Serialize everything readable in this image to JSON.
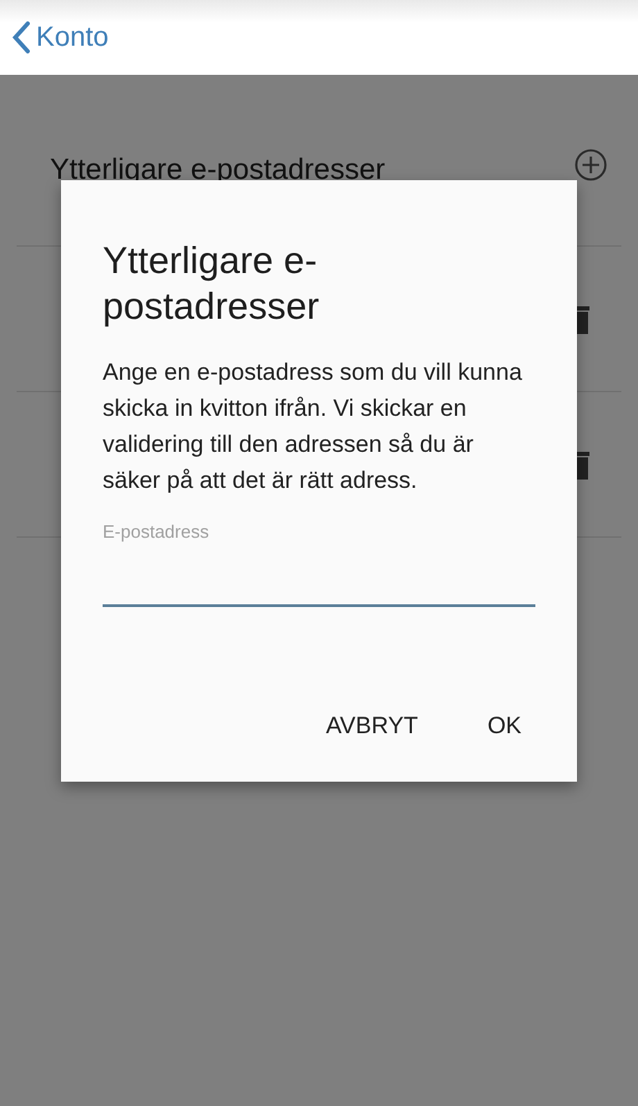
{
  "nav": {
    "back_label": "Konto"
  },
  "section": {
    "title": "Ytterligare e-postadresser",
    "rows": [
      {
        "kind": "email"
      },
      {
        "kind": "email"
      }
    ]
  },
  "dialog": {
    "title": "Ytterligare e-postadresser",
    "message": "Ange en e-postadress som du vill kunna skicka in kvitton ifrån. Vi skickar en validering till den adressen så du är säker på att det är rätt adress.",
    "field": {
      "label": "E-postadress"
    },
    "buttons": [
      "AVBRYT",
      "OK"
    ]
  }
}
